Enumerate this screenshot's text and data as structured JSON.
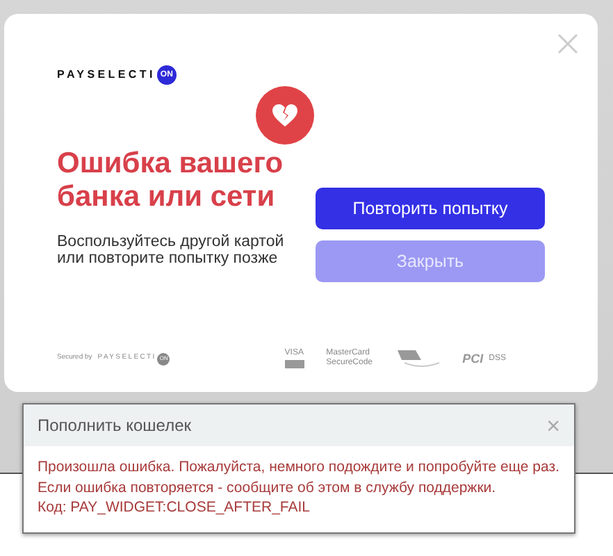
{
  "payment_modal": {
    "logo": {
      "text": "PAYSELECTI",
      "badge": "ON"
    },
    "title": "Ошибка вашего банка или сети",
    "message": "Воспользуйтесь другой картой или повторите попытку позже",
    "buttons": [
      {
        "label": "Повторить попытку",
        "kind": "primary"
      },
      {
        "label": "Закрыть",
        "kind": "secondary"
      }
    ],
    "footer": {
      "secured_by": "Secured by",
      "logo": {
        "text": "PAYSELECTI",
        "badge": "ON"
      },
      "badges": [
        {
          "kind": "visa",
          "text": "VISA"
        },
        {
          "kind": "mastercard",
          "text": "MasterCard SecureCode"
        },
        {
          "kind": "mir"
        },
        {
          "kind": "pci",
          "text": "PCI",
          "subtext": "DSS"
        }
      ]
    }
  },
  "alert_dialog": {
    "title": "Пополнить кошелек",
    "close": "×",
    "message": "Произошла ошибка. Пожалуйста, немного подождите и попробуйте еще раз. Если ошибка повторяется - сообщите об этом в службу поддержки.",
    "code": "Код: PAY_WIDGET:CLOSE_AFTER_FAIL"
  }
}
